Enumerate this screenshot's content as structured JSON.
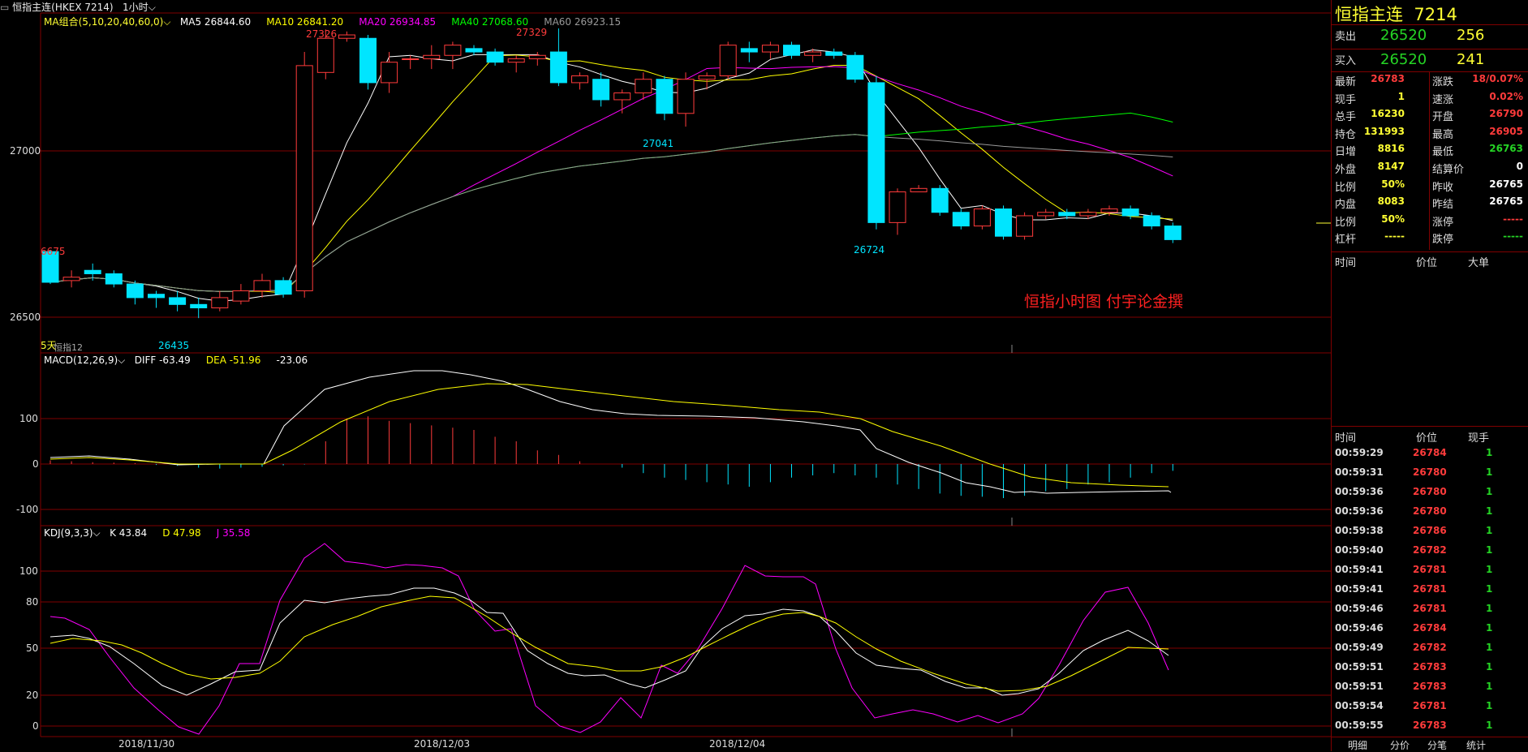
{
  "window": {
    "title": "恒指主连(HKEX 7214)",
    "period": "1小时"
  },
  "main_panel": {
    "indicator": "MA组合(5,10,20,40,60,0)",
    "ma": [
      {
        "label": "MA5 26844.60",
        "color": "#ffffff"
      },
      {
        "label": "MA10 26841.20",
        "color": "#ffff00"
      },
      {
        "label": "MA20 26934.85",
        "color": "#ff00ff"
      },
      {
        "label": "MA40 27068.60",
        "color": "#00ff00"
      },
      {
        "label": "MA60 26923.15",
        "color": "#999999"
      }
    ],
    "y_ticks": [
      "27000",
      "26500"
    ],
    "y_tick_values": [
      27000,
      26500
    ],
    "annotations": [
      {
        "text": "27326",
        "color": "#ff3b3b"
      },
      {
        "text": "27329",
        "color": "#ff3b3b"
      },
      {
        "text": "27041",
        "color": "#00e5ff"
      },
      {
        "text": "26724",
        "color": "#00e5ff"
      },
      {
        "text": "26435",
        "color": "#00e5ff"
      },
      {
        "text": "6675",
        "color": "#ff3b3b"
      }
    ],
    "watermark": "恒指小时图  付宇论金撰",
    "sub_label": "5天",
    "sub_label2": "恒指12"
  },
  "macd_panel": {
    "indicator": "MACD(12,26,9)",
    "diff": "DIFF -63.49",
    "dea": "DEA -51.96",
    "macd": "-23.06",
    "y_ticks": [
      "100",
      "0",
      "-100"
    ]
  },
  "kdj_panel": {
    "indicator": "KDJ(9,3,3)",
    "k": "K 43.84",
    "d": "D 47.98",
    "j": "J 35.58",
    "y_ticks": [
      "100",
      "80",
      "50",
      "20",
      "0"
    ]
  },
  "x_axis": [
    "2018/11/30",
    "2018/12/03",
    "2018/12/04"
  ],
  "chart_data": {
    "type": "candlestick",
    "ohlc": [
      [
        26675,
        26680,
        26580,
        26585
      ],
      [
        26590,
        26620,
        26570,
        26600
      ],
      [
        26620,
        26640,
        26590,
        26610
      ],
      [
        26610,
        26620,
        26570,
        26580
      ],
      [
        26580,
        26590,
        26520,
        26540
      ],
      [
        26550,
        26560,
        26510,
        26540
      ],
      [
        26540,
        26560,
        26500,
        26520
      ],
      [
        26520,
        26540,
        26480,
        26510
      ],
      [
        26510,
        26560,
        26500,
        26540
      ],
      [
        26530,
        26580,
        26520,
        26560
      ],
      [
        26560,
        26610,
        26540,
        26590
      ],
      [
        26590,
        26600,
        26540,
        26550
      ],
      [
        26560,
        27260,
        26540,
        27220
      ],
      [
        27200,
        27326,
        27180,
        27300
      ],
      [
        27300,
        27320,
        27290,
        27310
      ],
      [
        27300,
        27310,
        27150,
        27170
      ],
      [
        27170,
        27260,
        27140,
        27230
      ],
      [
        27240,
        27250,
        27210,
        27240
      ],
      [
        27240,
        27280,
        27210,
        27250
      ],
      [
        27250,
        27290,
        27210,
        27280
      ],
      [
        27270,
        27280,
        27250,
        27260
      ],
      [
        27260,
        27270,
        27220,
        27230
      ],
      [
        27230,
        27250,
        27200,
        27240
      ],
      [
        27240,
        27260,
        27220,
        27250
      ],
      [
        27260,
        27329,
        27160,
        27170
      ],
      [
        27170,
        27200,
        27150,
        27190
      ],
      [
        27180,
        27200,
        27100,
        27120
      ],
      [
        27120,
        27150,
        27080,
        27140
      ],
      [
        27140,
        27200,
        27120,
        27180
      ],
      [
        27180,
        27190,
        27060,
        27080
      ],
      [
        27080,
        27200,
        27041,
        27180
      ],
      [
        27180,
        27200,
        27150,
        27190
      ],
      [
        27190,
        27290,
        27180,
        27280
      ],
      [
        27270,
        27290,
        27230,
        27260
      ],
      [
        27260,
        27290,
        27240,
        27280
      ],
      [
        27280,
        27290,
        27240,
        27250
      ],
      [
        27250,
        27270,
        27230,
        27260
      ],
      [
        27260,
        27270,
        27240,
        27250
      ],
      [
        27250,
        27260,
        27170,
        27180
      ],
      [
        27170,
        27190,
        26740,
        26760
      ],
      [
        26760,
        26860,
        26724,
        26850
      ],
      [
        26850,
        26870,
        26850,
        26860
      ],
      [
        26860,
        26870,
        26780,
        26790
      ],
      [
        26790,
        26800,
        26740,
        26750
      ],
      [
        26750,
        26810,
        26740,
        26800
      ],
      [
        26800,
        26810,
        26710,
        26720
      ],
      [
        26720,
        26790,
        26710,
        26780
      ],
      [
        26780,
        26800,
        26770,
        26790
      ],
      [
        26790,
        26800,
        26770,
        26780
      ],
      [
        26780,
        26800,
        26770,
        26790
      ],
      [
        26790,
        26810,
        26780,
        26800
      ],
      [
        26800,
        26810,
        26770,
        26780
      ],
      [
        26780,
        26790,
        26740,
        26750
      ],
      [
        26750,
        26760,
        26700,
        26710
      ]
    ],
    "y_range": [
      26390,
      27360
    ]
  },
  "side": {
    "title": "恒指主连",
    "code": "7214",
    "sell": {
      "label": "卖出",
      "price": "26520",
      "vol": "256"
    },
    "buy": {
      "label": "买入",
      "price": "26520",
      "vol": "241"
    },
    "stats": [
      {
        "l1": "最新",
        "v1": "26783",
        "c1": "red",
        "l2": "涨跌",
        "v2": "18/0.07%",
        "c2": "red"
      },
      {
        "l1": "现手",
        "v1": "1",
        "c1": "yellow",
        "l2": "速涨",
        "v2": "0.02%",
        "c2": "red"
      },
      {
        "l1": "总手",
        "v1": "16230",
        "c1": "yellow",
        "l2": "开盘",
        "v2": "26790",
        "c2": "red"
      },
      {
        "l1": "持仓",
        "v1": "131993",
        "c1": "yellow",
        "l2": "最高",
        "v2": "26905",
        "c2": "red"
      },
      {
        "l1": "日增",
        "v1": "8816",
        "c1": "yellow",
        "l2": "最低",
        "v2": "26763",
        "c2": "green"
      },
      {
        "l1": "外盘",
        "v1": "8147",
        "c1": "yellow",
        "l2": "结算价",
        "v2": "0",
        "c2": "white"
      },
      {
        "l1": "比例",
        "v1": "50%",
        "c1": "yellow",
        "l2": "昨收",
        "v2": "26765",
        "c2": "white"
      },
      {
        "l1": "内盘",
        "v1": "8083",
        "c1": "yellow",
        "l2": "昨结",
        "v2": "26765",
        "c2": "white"
      },
      {
        "l1": "比例",
        "v1": "50%",
        "c1": "yellow",
        "l2": "涨停",
        "v2": "-----",
        "c2": "red"
      },
      {
        "l1": "杠杆",
        "v1": "-----",
        "c1": "yellow",
        "l2": "跌停",
        "v2": "-----",
        "c2": "green"
      }
    ],
    "big_header": [
      "时间",
      "价位",
      "大单"
    ],
    "tick_header": [
      "时间",
      "价位",
      "现手"
    ],
    "ticks": [
      [
        "00:59:29",
        "26784",
        "1"
      ],
      [
        "00:59:31",
        "26780",
        "1"
      ],
      [
        "00:59:36",
        "26780",
        "1"
      ],
      [
        "00:59:36",
        "26780",
        "1"
      ],
      [
        "00:59:38",
        "26786",
        "1"
      ],
      [
        "00:59:40",
        "26782",
        "1"
      ],
      [
        "00:59:41",
        "26781",
        "1"
      ],
      [
        "00:59:41",
        "26781",
        "1"
      ],
      [
        "00:59:46",
        "26781",
        "1"
      ],
      [
        "00:59:46",
        "26784",
        "1"
      ],
      [
        "00:59:49",
        "26782",
        "1"
      ],
      [
        "00:59:51",
        "26783",
        "1"
      ],
      [
        "00:59:51",
        "26783",
        "1"
      ],
      [
        "00:59:54",
        "26781",
        "1"
      ],
      [
        "00:59:55",
        "26783",
        "1"
      ]
    ],
    "tabs": [
      "明细",
      "分价",
      "分笔",
      "统计"
    ]
  }
}
